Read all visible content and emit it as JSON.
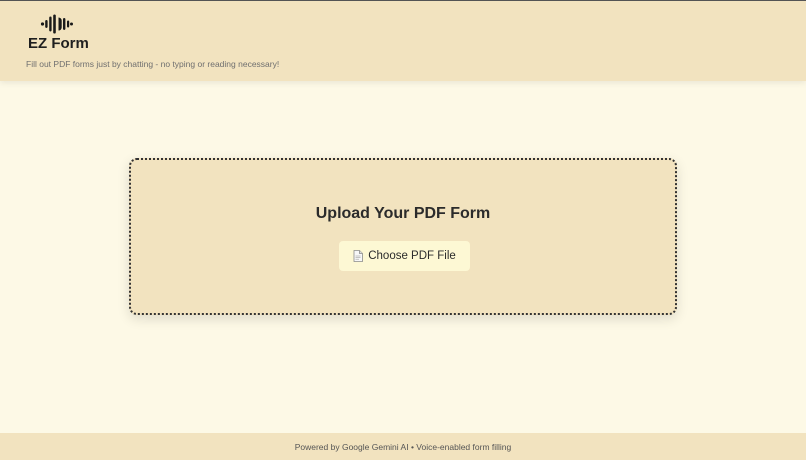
{
  "header": {
    "logo_icon": "voice-wave-icon",
    "title": "EZ Form",
    "tagline": "Fill out PDF forms just by chatting - no typing or reading necessary!"
  },
  "upload": {
    "title": "Upload Your PDF Form",
    "button_icon": "file-icon",
    "button_label": "Choose PDF File"
  },
  "footer": {
    "text": "Powered by Google Gemini AI • Voice-enabled form filling"
  },
  "colors": {
    "page_background": "#fdf9e6",
    "panel_background": "#f2e3bf",
    "button_background": "#fdf8d4",
    "text_dark": "#2b2b2b"
  }
}
